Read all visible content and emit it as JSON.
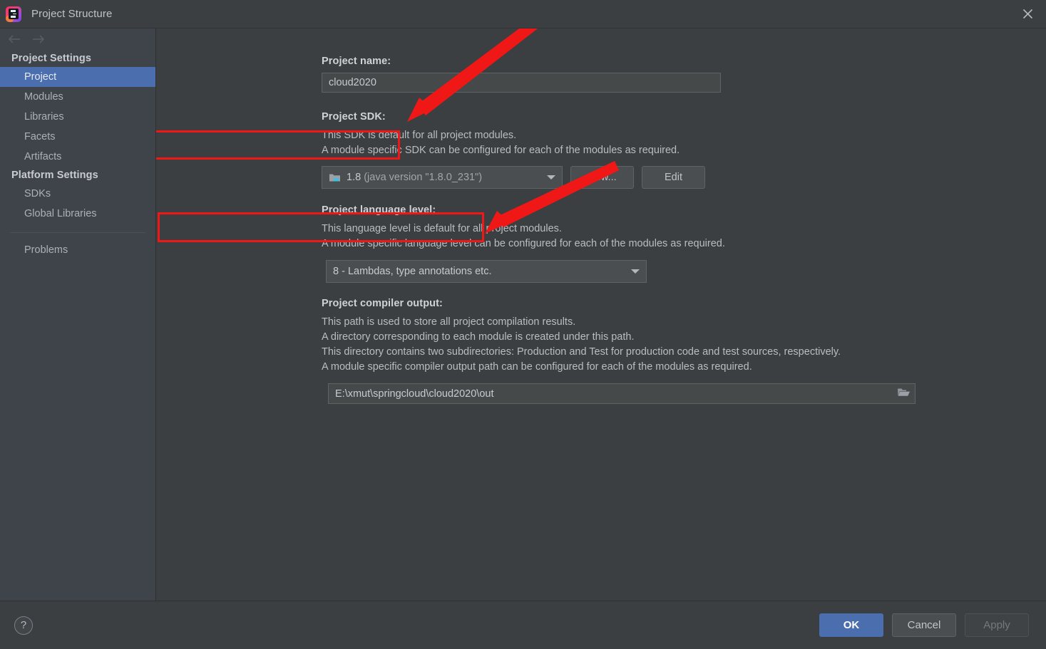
{
  "window": {
    "title": "Project Structure",
    "app_icon": "intellij-idea-logo",
    "close_icon": "close-icon"
  },
  "nav": {
    "back_icon": "arrow-left-icon",
    "forward_icon": "arrow-right-icon"
  },
  "sidebar": {
    "groups": [
      {
        "header": "Project Settings",
        "items": [
          {
            "label": "Project",
            "selected": true
          },
          {
            "label": "Modules",
            "selected": false
          },
          {
            "label": "Libraries",
            "selected": false
          },
          {
            "label": "Facets",
            "selected": false
          },
          {
            "label": "Artifacts",
            "selected": false
          }
        ]
      },
      {
        "header": "Platform Settings",
        "items": [
          {
            "label": "SDKs",
            "selected": false
          },
          {
            "label": "Global Libraries",
            "selected": false
          }
        ]
      }
    ],
    "extra": [
      {
        "label": "Problems"
      }
    ]
  },
  "main": {
    "project_name": {
      "label": "Project name:",
      "value": "cloud2020",
      "placeholder": ""
    },
    "project_sdk": {
      "label": "Project SDK:",
      "desc": [
        "This SDK is default for all project modules.",
        "A module specific SDK can be configured for each of the modules as required."
      ],
      "value_main": "1.8",
      "value_detail": "(java version \"1.8.0_231\")",
      "icon": "folder-icon",
      "dropdown_icon": "chevron-down-icon",
      "new_button": "New...",
      "edit_button": "Edit"
    },
    "language_level": {
      "label": "Project language level:",
      "desc": [
        "This language level is default for all project modules.",
        "A module specific language level can be configured for each of the modules as required."
      ],
      "value": "8 - Lambdas, type annotations etc.",
      "dropdown_icon": "chevron-down-icon"
    },
    "compiler_output": {
      "label": "Project compiler output:",
      "desc": [
        "This path is used to store all project compilation results.",
        "A directory corresponding to each module is created under this path.",
        "This directory contains two subdirectories: Production and Test for production code and test sources, respectively.",
        "A module specific compiler output path can be configured for each of the modules as required."
      ],
      "value": "E:\\xmut\\springcloud\\cloud2020\\out",
      "browse_icon": "folder-open-icon"
    }
  },
  "annotations": {
    "color": "#f01717",
    "boxes": [
      {
        "name": "sdk-highlight"
      },
      {
        "name": "language-level-highlight"
      }
    ],
    "arrows": [
      {
        "name": "sdk-arrow"
      },
      {
        "name": "language-level-arrow"
      }
    ]
  },
  "footer": {
    "help_icon": "question-mark-icon",
    "help_label": "?",
    "ok": "OK",
    "cancel": "Cancel",
    "apply": "Apply"
  },
  "colors": {
    "accent": "#4b6eaf",
    "panel_bg": "#3c3f41",
    "sidebar_bg": "#3f434a",
    "annotation_red": "#f01717"
  }
}
